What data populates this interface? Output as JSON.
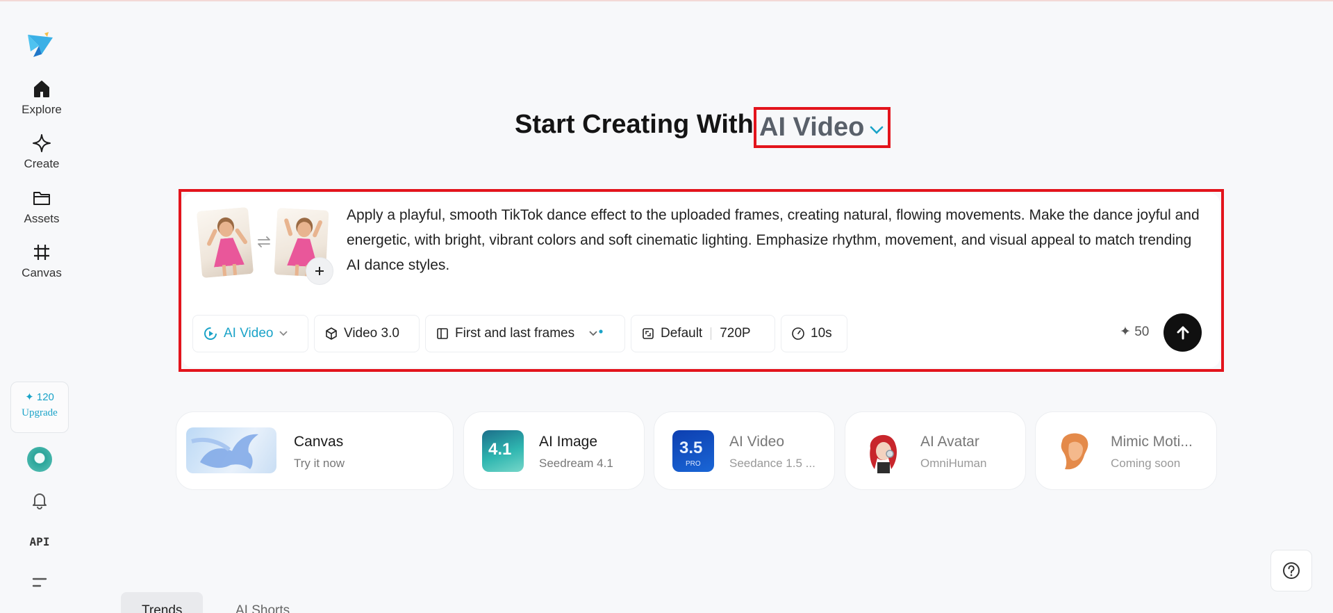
{
  "sidebar": {
    "items": [
      {
        "label": "Explore",
        "icon": "home-icon"
      },
      {
        "label": "Create",
        "icon": "sparkle-icon"
      },
      {
        "label": "Assets",
        "icon": "folder-icon"
      },
      {
        "label": "Canvas",
        "icon": "frame-icon"
      }
    ],
    "credits": "✦ 120",
    "upgrade_label": "Upgrade",
    "api_label": "API"
  },
  "hero": {
    "title_prefix": "Start Creating With",
    "mode_label": "AI Video"
  },
  "composer": {
    "prompt": "Apply a playful, smooth TikTok dance effect to the uploaded frames, creating natural, flowing movements. Make the dance joyful and energetic, with bright, vibrant colors and soft cinematic lighting. Emphasize rhythm, movement, and visual appeal to match trending AI dance styles.",
    "chips": {
      "mode": "AI Video",
      "model": "Video 3.0",
      "frames": "First and last frames",
      "ratio": "Default",
      "resolution": "720P",
      "duration": "10s"
    },
    "cost": "✦ 50"
  },
  "cards": [
    {
      "title": "Canvas",
      "subtitle": "Try it now"
    },
    {
      "title": "AI Image",
      "subtitle": "Seedream 4.1",
      "badge": "4.1"
    },
    {
      "title": "AI Video",
      "subtitle": "Seedance 1.5 ...",
      "badge": "3.5",
      "badge_sub": "PRO"
    },
    {
      "title": "AI Avatar",
      "subtitle": "OmniHuman"
    },
    {
      "title": "Mimic Moti...",
      "subtitle": "Coming soon"
    }
  ],
  "tabs": [
    "Trends",
    "AI Shorts"
  ],
  "colors": {
    "accent": "#1aa3c8",
    "highlight": "#e3141c"
  }
}
